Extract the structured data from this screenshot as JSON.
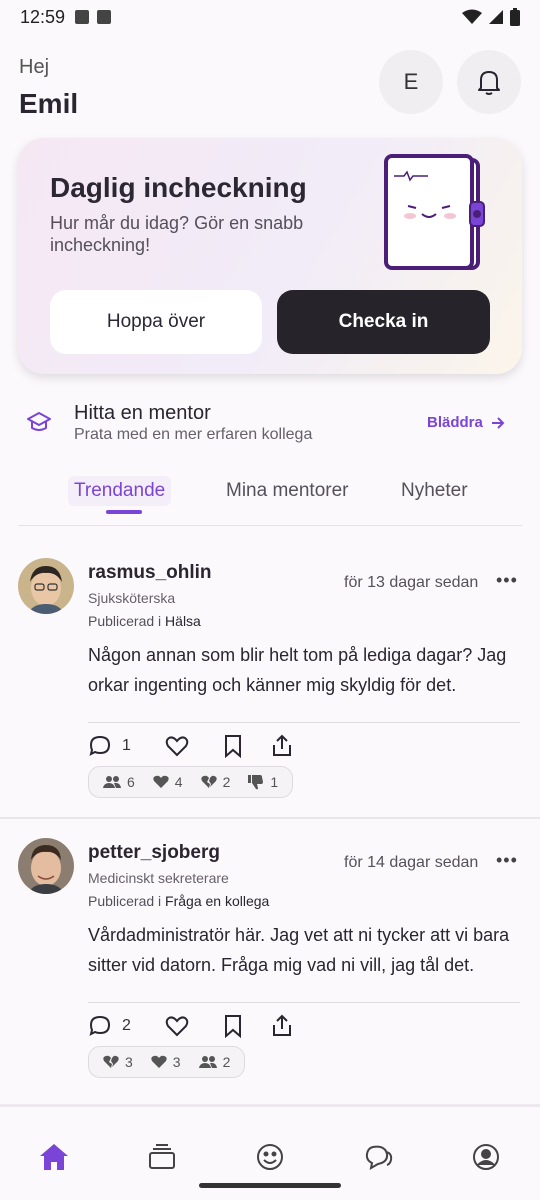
{
  "status_bar": {
    "time": "12:59"
  },
  "header": {
    "greeting": "Hej",
    "name": "Emil",
    "avatar_initial": "E"
  },
  "checkin": {
    "title": "Daglig incheckning",
    "subtitle": "Hur mår du idag? Gör en snabb incheckning!",
    "skip_label": "Hoppa över",
    "checkin_label": "Checka in"
  },
  "mentor": {
    "title": "Hitta en mentor",
    "subtitle": "Prata med en mer erfaren kollega",
    "browse_label": "Bläddra"
  },
  "tabs": [
    {
      "label": "Trendande",
      "active": true
    },
    {
      "label": "Mina mentorer",
      "active": false
    },
    {
      "label": "Nyheter",
      "active": false
    }
  ],
  "posts": [
    {
      "username": "rasmus_ohlin",
      "role": "Sjuksköterska",
      "published_prefix": "Publicerad i",
      "category": "Hälsa",
      "time": "för 13 dagar sedan",
      "body": "Någon annan som blir helt tom på lediga dagar? Jag orkar ingenting och känner mig skyldig för det.",
      "comment_count": "1",
      "reactions": [
        {
          "icon": "people-icon",
          "count": "6"
        },
        {
          "icon": "heart-icon",
          "count": "4"
        },
        {
          "icon": "broken-heart-icon",
          "count": "2"
        },
        {
          "icon": "thumbs-down-icon",
          "count": "1"
        }
      ]
    },
    {
      "username": "petter_sjoberg",
      "role": "Medicinskt sekreterare",
      "published_prefix": "Publicerad i",
      "category": "Fråga en kollega",
      "time": "för 14 dagar sedan",
      "body": "Vårdadministratör här. Jag vet att ni tycker att vi bara sitter vid datorn. Fråga mig vad ni vill, jag tål det.",
      "comment_count": "2",
      "reactions": [
        {
          "icon": "broken-heart-icon",
          "count": "3"
        },
        {
          "icon": "heart-icon",
          "count": "3"
        },
        {
          "icon": "people-icon",
          "count": "2"
        }
      ]
    }
  ],
  "colors": {
    "accent": "#7a45d6",
    "dark_button": "#26232b"
  }
}
